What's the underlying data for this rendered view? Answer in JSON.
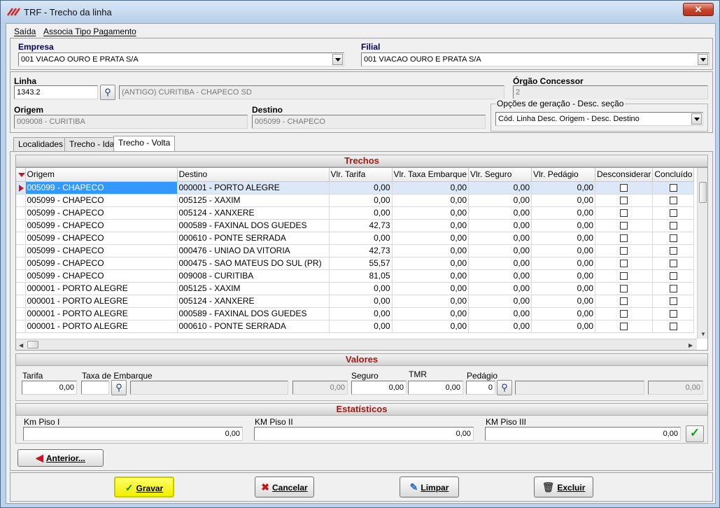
{
  "window": {
    "title": "TRF - Trecho da linha",
    "close_glyph": "✕"
  },
  "menu": {
    "items": [
      "Saída",
      "Associa Tipo Pagamento"
    ]
  },
  "empresa": {
    "label": "Empresa",
    "value": "001 VIACAO OURO E PRATA S/A"
  },
  "filial": {
    "label": "Filial",
    "value": "001 VIACAO OURO E PRATA S/A"
  },
  "linha": {
    "label": "Linha",
    "code": "1343.2",
    "description": "(ANTIGO) CURITIBA - CHAPECO SD"
  },
  "orgao": {
    "label": "Órgão Concessor",
    "value": "2"
  },
  "origem": {
    "label": "Origem",
    "value": "009008 - CURITIBA"
  },
  "destino": {
    "label": "Destino",
    "value": "005099 - CHAPECO"
  },
  "opcoes": {
    "label": "Opções de geração - Desc. seção",
    "value": "Cód. Linha Desc. Origem - Desc. Destino"
  },
  "tabs": [
    "Localidades",
    "Trecho - Ida",
    "Trecho - Volta"
  ],
  "trechos": {
    "title": "Trechos",
    "columns": [
      "Origem",
      "Destino",
      "Vlr. Tarifa",
      "Vlr. Taxa Embarque",
      "Vlr. Seguro",
      "Vlr. Pedágio",
      "Desconsiderar",
      "Concluído"
    ],
    "rows": [
      {
        "origem": "005099 - CHAPECO",
        "destino": "000001 - PORTO ALEGRE",
        "tarifa": "0,00",
        "taxa": "0,00",
        "seguro": "0,00",
        "pedagio": "0,00",
        "desconsiderar": false,
        "concluido": false
      },
      {
        "origem": "005099 - CHAPECO",
        "destino": "005125 - XAXIM",
        "tarifa": "0,00",
        "taxa": "0,00",
        "seguro": "0,00",
        "pedagio": "0,00",
        "desconsiderar": false,
        "concluido": false
      },
      {
        "origem": "005099 - CHAPECO",
        "destino": "005124 - XANXERE",
        "tarifa": "0,00",
        "taxa": "0,00",
        "seguro": "0,00",
        "pedagio": "0,00",
        "desconsiderar": false,
        "concluido": false
      },
      {
        "origem": "005099 - CHAPECO",
        "destino": "000589 - FAXINAL DOS GUEDES",
        "tarifa": "42,73",
        "taxa": "0,00",
        "seguro": "0,00",
        "pedagio": "0,00",
        "desconsiderar": false,
        "concluido": false
      },
      {
        "origem": "005099 - CHAPECO",
        "destino": "000610 - PONTE SERRADA",
        "tarifa": "0,00",
        "taxa": "0,00",
        "seguro": "0,00",
        "pedagio": "0,00",
        "desconsiderar": false,
        "concluido": false
      },
      {
        "origem": "005099 - CHAPECO",
        "destino": "000476 - UNIAO DA VITORIA",
        "tarifa": "42,73",
        "taxa": "0,00",
        "seguro": "0,00",
        "pedagio": "0,00",
        "desconsiderar": false,
        "concluido": false
      },
      {
        "origem": "005099 - CHAPECO",
        "destino": "000475 - SAO MATEUS DO SUL (PR)",
        "tarifa": "55,57",
        "taxa": "0,00",
        "seguro": "0,00",
        "pedagio": "0,00",
        "desconsiderar": false,
        "concluido": false
      },
      {
        "origem": "005099 - CHAPECO",
        "destino": "009008 - CURITIBA",
        "tarifa": "81,05",
        "taxa": "0,00",
        "seguro": "0,00",
        "pedagio": "0,00",
        "desconsiderar": false,
        "concluido": false
      },
      {
        "origem": "000001 - PORTO ALEGRE",
        "destino": "005125 - XAXIM",
        "tarifa": "0,00",
        "taxa": "0,00",
        "seguro": "0,00",
        "pedagio": "0,00",
        "desconsiderar": false,
        "concluido": false
      },
      {
        "origem": "000001 - PORTO ALEGRE",
        "destino": "005124 - XANXERE",
        "tarifa": "0,00",
        "taxa": "0,00",
        "seguro": "0,00",
        "pedagio": "0,00",
        "desconsiderar": false,
        "concluido": false
      },
      {
        "origem": "000001 - PORTO ALEGRE",
        "destino": "000589 - FAXINAL DOS GUEDES",
        "tarifa": "0,00",
        "taxa": "0,00",
        "seguro": "0,00",
        "pedagio": "0,00",
        "desconsiderar": false,
        "concluido": false
      },
      {
        "origem": "000001 - PORTO ALEGRE",
        "destino": "000610 - PONTE SERRADA",
        "tarifa": "0,00",
        "taxa": "0,00",
        "seguro": "0,00",
        "pedagio": "0,00",
        "desconsiderar": false,
        "concluido": false
      }
    ]
  },
  "valores": {
    "title": "Valores",
    "tarifa_label": "Tarifa",
    "tarifa": "0,00",
    "taxa_label": "Taxa de Embarque",
    "taxa_code": "",
    "taxa_desc": "",
    "taxa_value": "0,00",
    "seguro_label": "Seguro",
    "seguro": "0,00",
    "tmr_label": "TMR",
    "tmr": "0,00",
    "pedagio_label": "Pedágio",
    "pedagio_code": "0",
    "pedagio_desc": "",
    "pedagio_value": "0,00"
  },
  "estatisticos": {
    "title": "Estatísticos",
    "km1_label": "Km Piso I",
    "km1": "0,00",
    "km2_label": "KM Piso II",
    "km2": "0,00",
    "km3_label": "KM Piso III",
    "km3": "0,00"
  },
  "buttons": {
    "anterior": "Anterior...",
    "gravar": "Gravar",
    "cancelar": "Cancelar",
    "limpar": "Limpar",
    "excluir": "Excluir"
  },
  "colors": {
    "section_title": "#a01a12",
    "selection": "#3399ff",
    "primary_button": "#f0f000"
  }
}
